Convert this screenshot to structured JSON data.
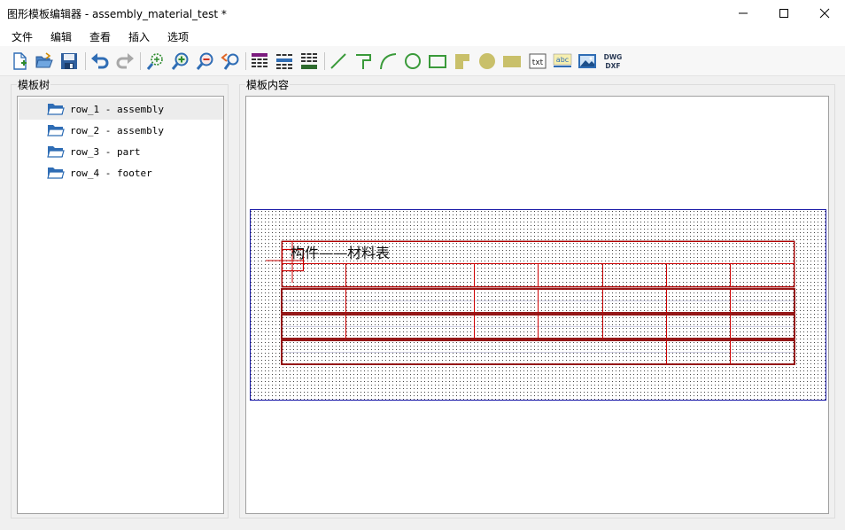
{
  "window": {
    "title": "图形模板编辑器 - assembly_material_test *"
  },
  "menu": {
    "items": [
      {
        "label": "文件"
      },
      {
        "label": "编辑"
      },
      {
        "label": "查看"
      },
      {
        "label": "插入"
      },
      {
        "label": "选项"
      }
    ]
  },
  "toolbar": {
    "buttons": [
      {
        "icon": "new-file-icon"
      },
      {
        "icon": "open-folder-icon"
      },
      {
        "icon": "save-icon"
      },
      {
        "icon": "undo-icon"
      },
      {
        "icon": "redo-icon"
      },
      {
        "icon": "zoom-fit-icon"
      },
      {
        "icon": "zoom-in-icon"
      },
      {
        "icon": "zoom-out-icon"
      },
      {
        "icon": "zoom-previous-icon"
      },
      {
        "icon": "insert-table-header-icon"
      },
      {
        "icon": "insert-table-row-icon"
      },
      {
        "icon": "insert-table-footer-icon"
      },
      {
        "icon": "draw-line-icon"
      },
      {
        "icon": "draw-polyline-icon"
      },
      {
        "icon": "draw-arc-icon"
      },
      {
        "icon": "draw-circle-icon"
      },
      {
        "icon": "draw-rectangle-icon"
      },
      {
        "icon": "draw-filled-polygon-icon"
      },
      {
        "icon": "draw-filled-circle-icon"
      },
      {
        "icon": "draw-filled-rectangle-icon"
      },
      {
        "icon": "insert-text-icon"
      },
      {
        "icon": "insert-attribute-text-icon"
      },
      {
        "icon": "insert-image-icon"
      },
      {
        "icon": "import-dwg-dxf-icon"
      }
    ],
    "txt_label": "txt",
    "abc_label": "abc",
    "dwg_label": "DWG",
    "dxf_label": "DXF"
  },
  "left_panel": {
    "title": "模板树",
    "items": [
      {
        "label": "row_1 - assembly",
        "selected": true
      },
      {
        "label": "row_2 - assembly",
        "selected": false
      },
      {
        "label": "row_3 - part",
        "selected": false
      },
      {
        "label": "row_4 - footer",
        "selected": false
      }
    ]
  },
  "right_panel": {
    "title": "模板内容",
    "table_title": "构件——材料表"
  },
  "colors": {
    "table_line": "#cc0000",
    "frame": "#1a1aa8",
    "folder": "#2f6db5"
  }
}
